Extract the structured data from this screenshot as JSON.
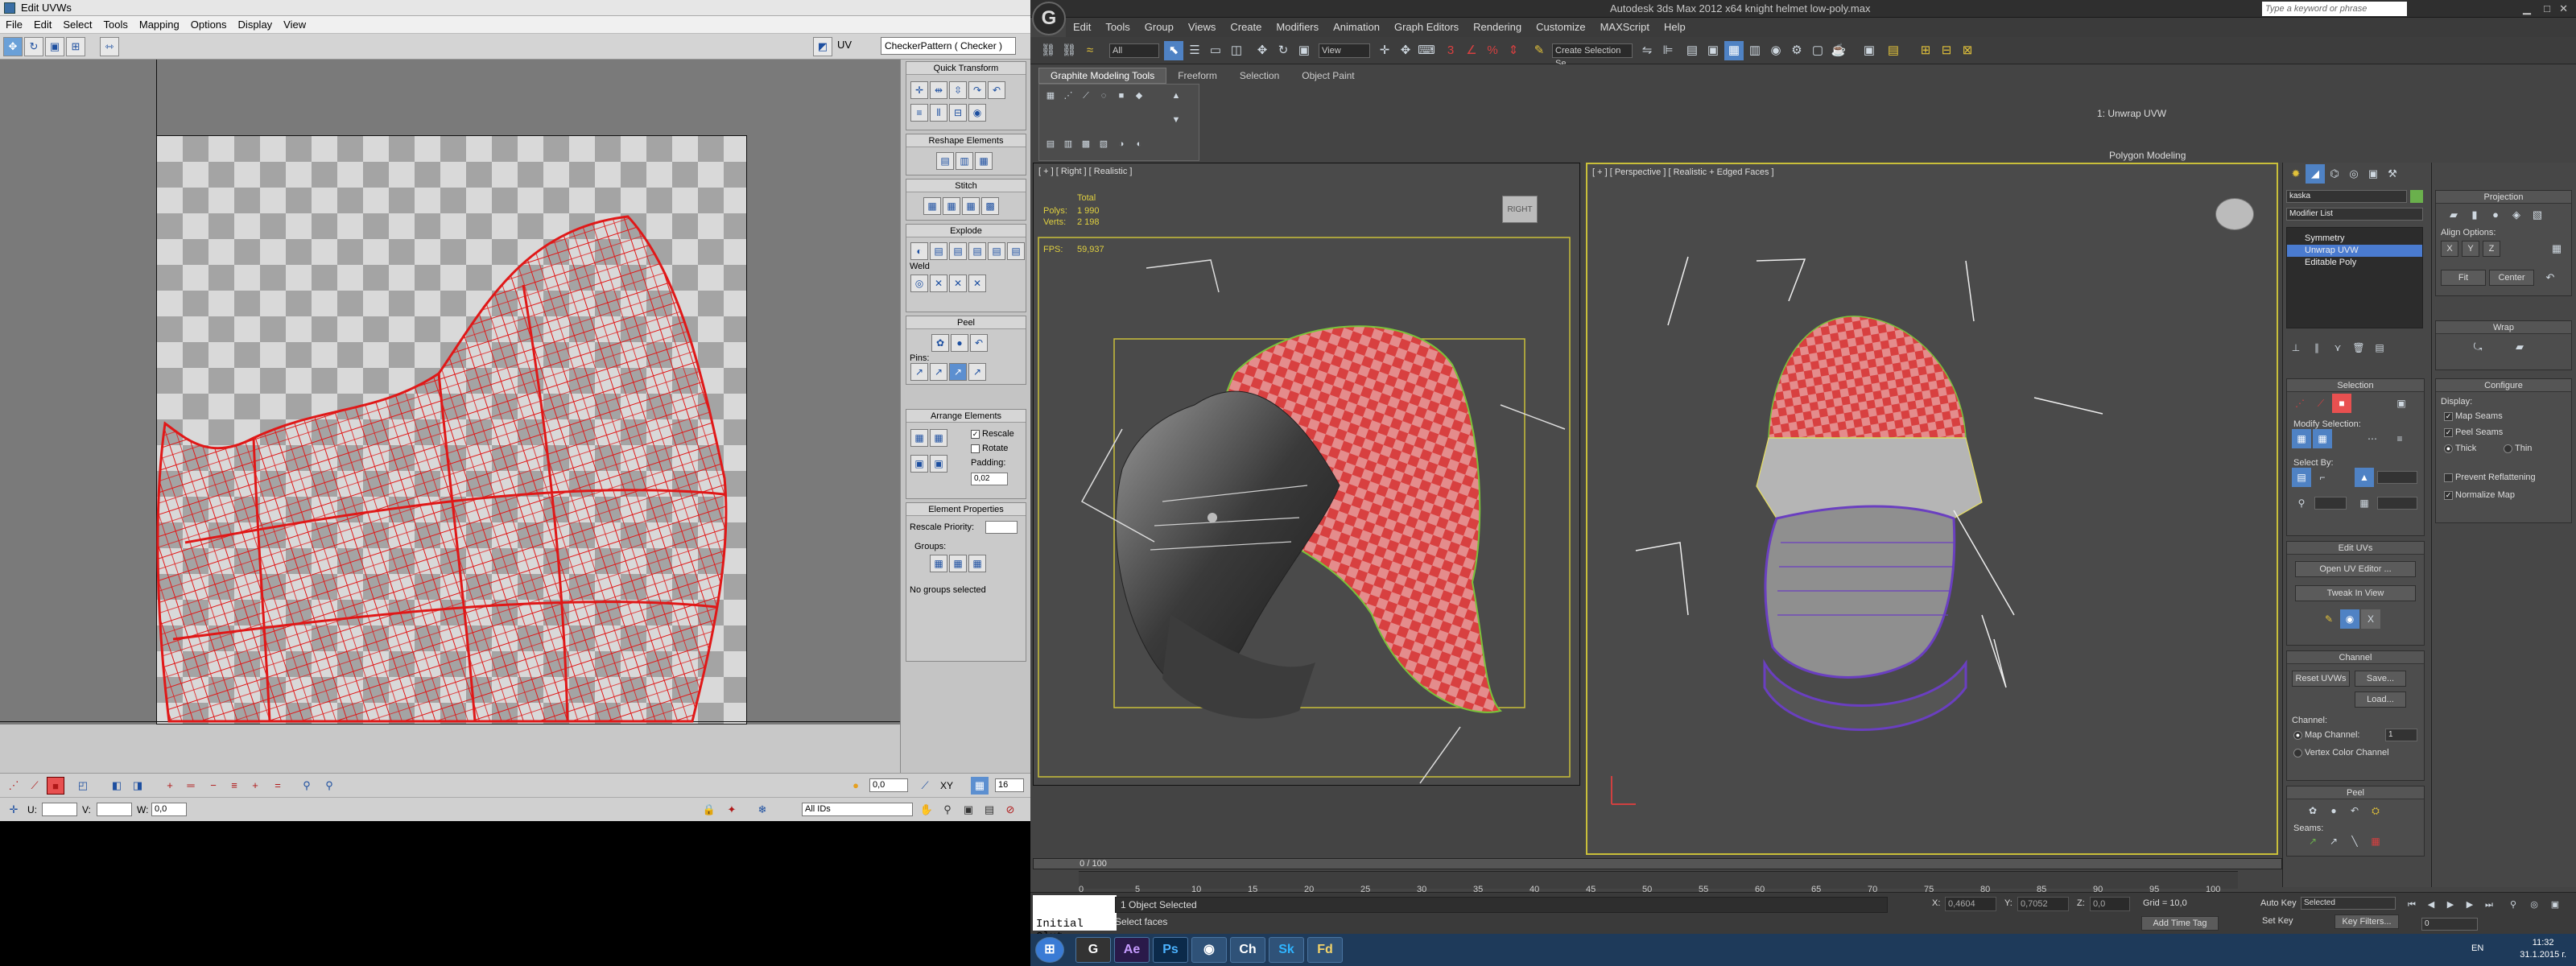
{
  "uvw": {
    "title": "Edit UVWs",
    "menu": [
      "File",
      "Edit",
      "Select",
      "Tools",
      "Mapping",
      "Options",
      "Display",
      "View"
    ],
    "uv_label": "UV",
    "texture_select": "CheckerPattern  ( Checker )",
    "rollouts": {
      "quick_transform": "Quick Transform",
      "reshape": "Reshape Elements",
      "stitch": "Stitch",
      "explode": "Explode",
      "weld": "Weld",
      "peel": "Peel",
      "pins": "Pins:",
      "arrange": "Arrange Elements",
      "rescale": "Rescale",
      "rotate": "Rotate",
      "padding": "Padding:",
      "padding_value": "0,02",
      "element_props": "Element Properties",
      "rescale_priority": "Rescale Priority:",
      "groups": "Groups:",
      "no_groups": "No groups selected"
    },
    "bottom": {
      "spin_value": "0,0",
      "xy": "XY",
      "u": "U:",
      "v": "V:",
      "w": "W:",
      "w_value": "0,0",
      "ids": "All IDs",
      "zoom": "16"
    }
  },
  "max": {
    "title": "Autodesk 3ds Max  2012 x64        knight helmet low-poly.max",
    "search_placeholder": "Type a keyword or phrase",
    "menu": [
      "Edit",
      "Tools",
      "Group",
      "Views",
      "Create",
      "Modifiers",
      "Animation",
      "Graph Editors",
      "Rendering",
      "Customize",
      "MAXScript",
      "Help"
    ],
    "selection_filter": "All",
    "ref_coord": "View",
    "named_sel": "Create Selection Se",
    "ribbon": {
      "tabs": [
        "Graphite Modeling Tools",
        "Freeform",
        "Selection",
        "Object Paint"
      ],
      "unwrap": "1: Unwrap UVW",
      "poly_modeling": "Polygon Modeling"
    },
    "viewports": {
      "right": {
        "label": "[ + ] [ Right ] [ Realistic ]",
        "total": "Total",
        "polys_label": "Polys:",
        "polys": "1 990",
        "verts_label": "Verts:",
        "verts": "2 198",
        "fps_label": "FPS:",
        "fps": "59,937"
      },
      "persp": {
        "label": "[ + ] [ Perspective ] [ Realistic + Edged Faces ]"
      }
    },
    "cmd": {
      "object_name": "kaska",
      "modifier_list": "Modifier List",
      "stack": [
        "Symmetry",
        "Unwrap UVW",
        "Editable Poly"
      ],
      "selection": "Selection",
      "modify_selection": "Modify Selection:",
      "select_by": "Select By:",
      "edit_uvs": "Edit UVs",
      "open_uv_editor": "Open UV Editor ...",
      "tweak_in_view": "Tweak In View",
      "channel": "Channel",
      "reset_uvws": "Reset UVWs",
      "save": "Save...",
      "load": "Load...",
      "channel_lbl": "Channel:",
      "map_channel": "Map Channel:",
      "map_channel_value": "1",
      "vertex_color": "Vertex Color Channel",
      "peel": "Peel",
      "seams": "Seams:",
      "projection": "Projection",
      "align_options": "Align Options:",
      "fit": "Fit",
      "center": "Center",
      "wrap": "Wrap",
      "configure": "Configure",
      "display": "Display:",
      "map_seams": "Map Seams",
      "peel_seams": "Peel Seams",
      "thick": "Thick",
      "thin": "Thin",
      "prevent_reflattening": "Prevent Reflattening",
      "normalize_map": "Normalize Map",
      "align_xyz": [
        "X",
        "Y",
        "Z"
      ]
    },
    "time": {
      "frame": "0 / 100",
      "ticks": [
        "0",
        "5",
        "10",
        "15",
        "20",
        "25",
        "30",
        "35",
        "40",
        "45",
        "50",
        "55",
        "60",
        "65",
        "70",
        "75",
        "80",
        "85",
        "90",
        "95",
        "100"
      ]
    },
    "status": {
      "initial": "Initial Clut",
      "selected": "1 Object Selected",
      "prompt": "Select faces",
      "x_label": "X:",
      "x": "0,4604",
      "y_label": "Y:",
      "y": "0,7052",
      "z_label": "Z:",
      "z": "0,0",
      "grid": "Grid = 10,0",
      "auto_key": "Auto Key",
      "set_key": "Set Key",
      "selected_combo": "Selected",
      "key_filters": "Key Filters...",
      "add_time_tag": "Add Time Tag",
      "frame_value": "0"
    },
    "taskbar": {
      "apps": [
        "Ae",
        "Ps",
        "Ch",
        "Sk",
        "Fd"
      ],
      "lang": "EN",
      "time": "11:32",
      "date": "31.1.2015 г."
    }
  },
  "colors": {
    "uv_wire": "#e01818",
    "persp_border": "#c9bf3a",
    "select_blue": "#4a7bd0"
  }
}
